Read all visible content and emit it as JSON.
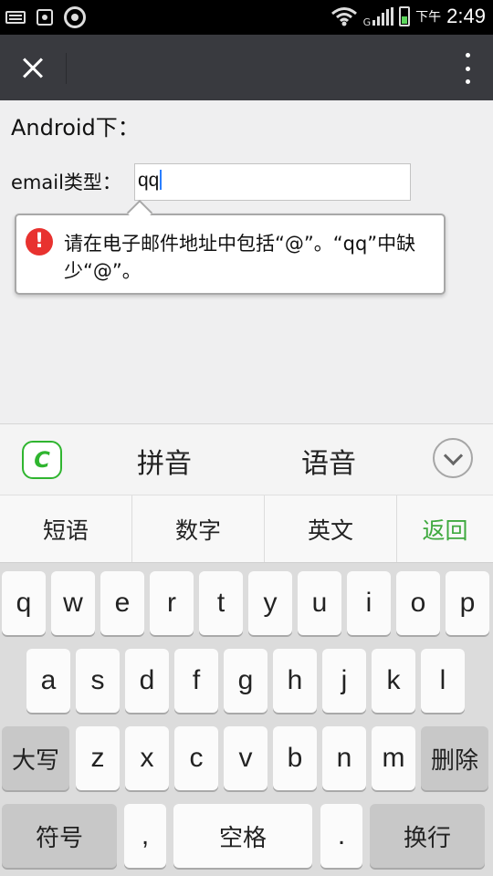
{
  "status_bar": {
    "ampm": "下午",
    "time": "2:49",
    "network": "G"
  },
  "page": {
    "heading": "Android下：",
    "email_label": "email类型：",
    "email_value": "qq",
    "validation_message": "请在电子邮件地址中包括“@”。“qq”中缺少“@”。"
  },
  "ime": {
    "logo": "C",
    "tabs": [
      "拼音",
      "语音"
    ],
    "shortcuts": [
      "短语",
      "数字",
      "英文",
      "返回"
    ],
    "row1": [
      "q",
      "w",
      "e",
      "r",
      "t",
      "y",
      "u",
      "i",
      "o",
      "p"
    ],
    "row2": [
      "a",
      "s",
      "d",
      "f",
      "g",
      "h",
      "j",
      "k",
      "l"
    ],
    "row3": [
      "z",
      "x",
      "c",
      "v",
      "b",
      "n",
      "m"
    ],
    "caps_label": "大写",
    "delete_label": "删除",
    "symbol_label": "符号",
    "comma_label": ",",
    "space_label": "空格",
    "period_label": ".",
    "enter_label": "换行"
  },
  "colors": {
    "toolbar": "#393a3f",
    "error": "#e8322f",
    "ime_green": "#3fa93f"
  }
}
